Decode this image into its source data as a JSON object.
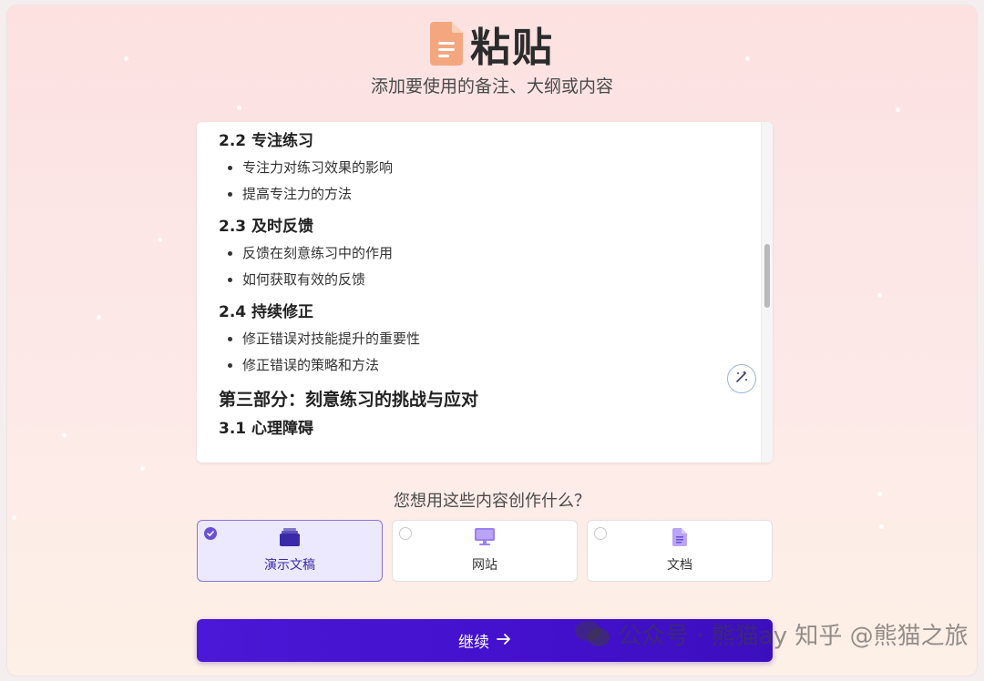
{
  "header": {
    "title": "粘贴",
    "subtitle": "添加要使用的备注、大纲或内容",
    "icon": "document-icon",
    "icon_color": "#f4a77f"
  },
  "editor": {
    "sections": [
      {
        "heading": "2.2 专注练习",
        "level": 3,
        "bullets": [
          "专注力对练习效果的影响",
          "提高专注力的方法"
        ]
      },
      {
        "heading": "2.3 及时反馈",
        "level": 3,
        "bullets": [
          "反馈在刻意练习中的作用",
          "如何获取有效的反馈"
        ]
      },
      {
        "heading": "2.4 持续修正",
        "level": 3,
        "bullets": [
          "修正错误对技能提升的重要性",
          "修正错误的策略和方法"
        ]
      },
      {
        "heading": "第三部分：刻意练习的挑战与应对",
        "level": 2,
        "bullets": []
      },
      {
        "heading": "3.1 心理障碍",
        "level": 3,
        "bullets": []
      }
    ],
    "magic_icon": "magic-wand-icon"
  },
  "question": "您想用这些内容创作什么？",
  "options": [
    {
      "label": "演示文稿",
      "icon": "presentation-icon",
      "selected": true
    },
    {
      "label": "网站",
      "icon": "monitor-icon",
      "selected": false
    },
    {
      "label": "文档",
      "icon": "document-icon",
      "selected": false
    }
  ],
  "continue_button": {
    "label": "继续",
    "icon": "arrow-right-icon"
  },
  "watermark": {
    "text": "公众号 · 熊猫ay 知乎 @熊猫之旅"
  },
  "colors": {
    "accent": "#4a18d6",
    "selected_bg": "#ece8fd",
    "selected_border": "#8a74e0"
  }
}
